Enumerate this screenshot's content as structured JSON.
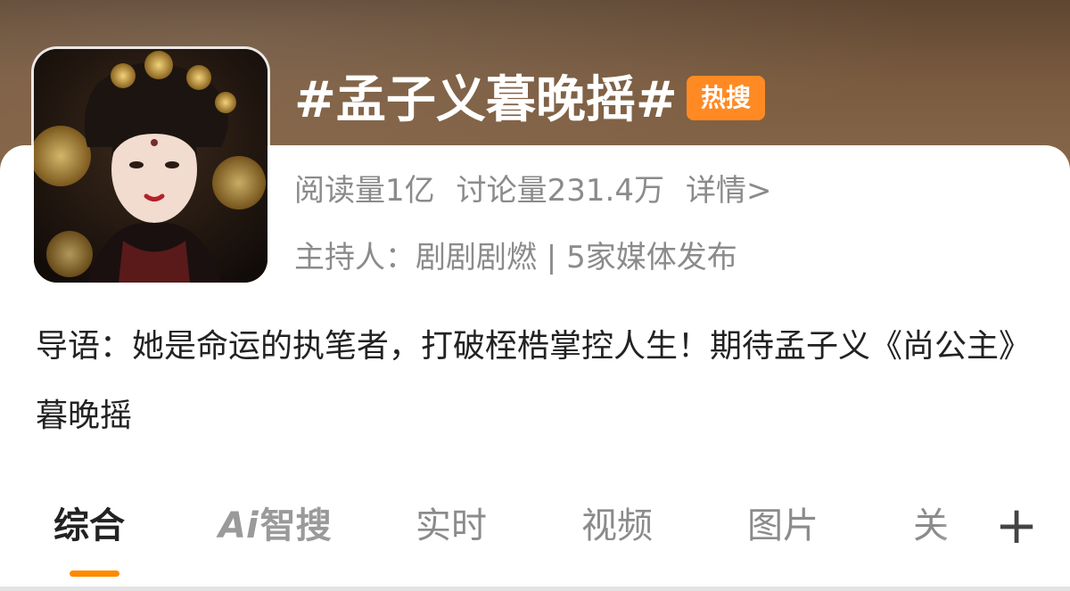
{
  "topic": {
    "title": "#孟子义暮晚摇#",
    "badge": "热搜",
    "read_count": "阅读量1亿",
    "discuss_count": "讨论量231.4万",
    "detail_link": "详情>",
    "host": "主持人：剧剧剧燃 | 5家媒体发布"
  },
  "guide": {
    "text": "导语：她是命运的执笔者，打破桎梏掌控人生！期待孟子义《尚公主》暮晚摇"
  },
  "tabs": [
    {
      "label": "综合"
    },
    {
      "label_ai": "Ai",
      "label_rest": "智搜"
    },
    {
      "label": "实时"
    },
    {
      "label": "视频"
    },
    {
      "label": "图片"
    },
    {
      "label": "关"
    }
  ],
  "colors": {
    "accent": "#ff8a00",
    "badge": "#ff8a24",
    "header": "#6e523a"
  },
  "icons": {
    "add": "plus-icon"
  }
}
